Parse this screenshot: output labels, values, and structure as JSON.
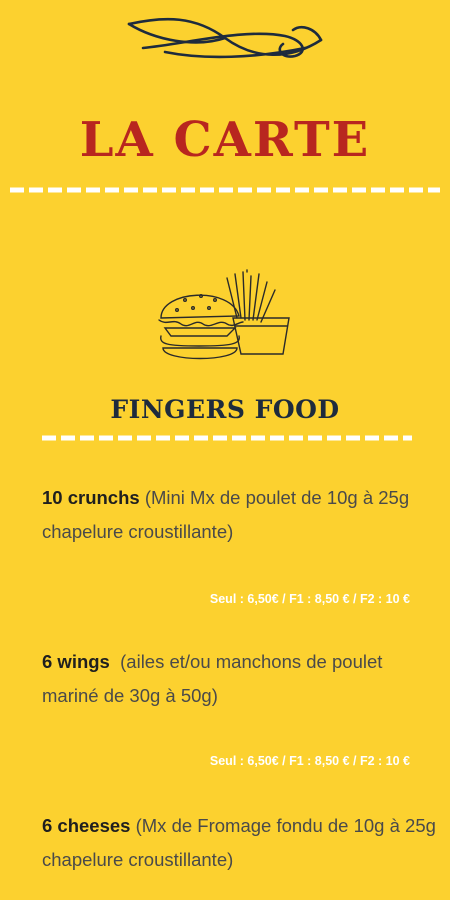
{
  "header": {
    "title": "LA CARTE"
  },
  "section": {
    "title": "FINGERS FOOD"
  },
  "items": [
    {
      "name": "10 crunchs",
      "description": " (Mini Mx de poulet de 10g à 25g chapelure croustillante)",
      "price": "Seul : 6,50€ / F1 : 8,50 € / F2 : 10 €"
    },
    {
      "name": "6 wings",
      "description": "  (ailes et/ou manchons de poulet mariné de 30g à 50g)",
      "price": "Seul : 6,50€ / F1 : 8,50 € / F2 : 10 €"
    },
    {
      "name": "6 cheeses",
      "description": " (Mx de Fromage fondu de 10g à 25g chapelure croustillante)"
    }
  ],
  "colors": {
    "background": "#fcd12f",
    "title": "#b8261f",
    "section_title": "#1e2b3d",
    "price": "#ffffff"
  },
  "icons": [
    "ornament-flourish-icon",
    "burger-fries-illustration-icon"
  ]
}
